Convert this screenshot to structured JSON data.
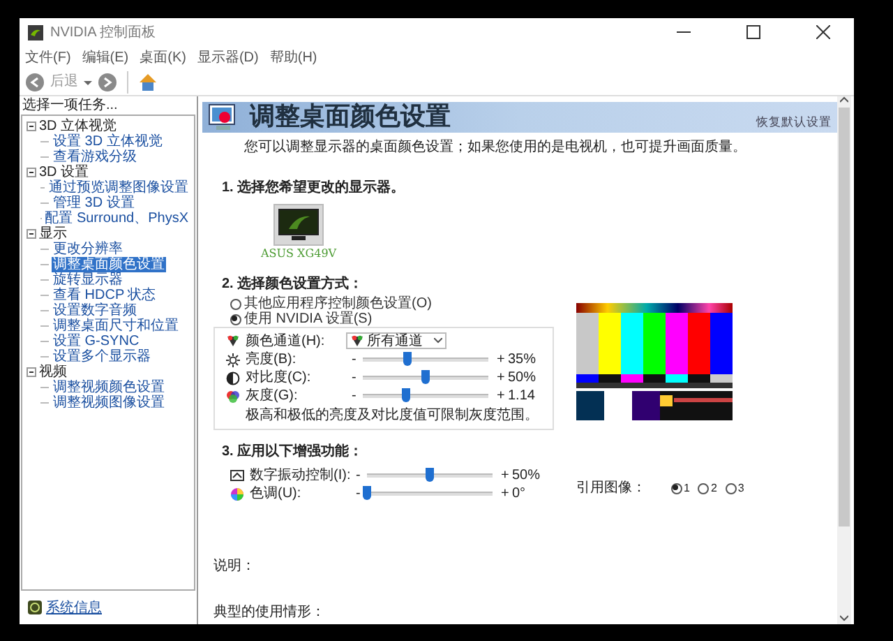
{
  "window": {
    "title": "NVIDIA 控制面板"
  },
  "menu": [
    "文件(F)",
    "编辑(E)",
    "桌面(K)",
    "显示器(D)",
    "帮助(H)"
  ],
  "toolbar": {
    "back_label": "后退"
  },
  "sidebar": {
    "heading": "选择一项任务...",
    "tree": [
      {
        "label": "3D 立体视觉",
        "expanded": true,
        "children": [
          {
            "label": "设置 3D 立体视觉",
            "selected": false
          },
          {
            "label": "查看游戏分级",
            "selected": false
          }
        ]
      },
      {
        "label": "3D 设置",
        "expanded": true,
        "children": [
          {
            "label": "通过预览调整图像设置",
            "selected": false
          },
          {
            "label": "管理 3D 设置",
            "selected": false
          },
          {
            "label": "配置 Surround、PhysX",
            "selected": false
          }
        ]
      },
      {
        "label": "显示",
        "expanded": true,
        "children": [
          {
            "label": "更改分辨率",
            "selected": false
          },
          {
            "label": "调整桌面颜色设置",
            "selected": true
          },
          {
            "label": "旋转显示器",
            "selected": false
          },
          {
            "label": "查看 HDCP 状态",
            "selected": false
          },
          {
            "label": "设置数字音频",
            "selected": false
          },
          {
            "label": "调整桌面尺寸和位置",
            "selected": false
          },
          {
            "label": "设置 G-SYNC",
            "selected": false
          },
          {
            "label": "设置多个显示器",
            "selected": false
          }
        ]
      },
      {
        "label": "视频",
        "expanded": true,
        "children": [
          {
            "label": "调整视频颜色设置",
            "selected": false
          },
          {
            "label": "调整视频图像设置",
            "selected": false
          }
        ]
      }
    ],
    "footer_link": "系统信息"
  },
  "page": {
    "title": "调整桌面颜色设置",
    "restore_link": "恢复默认设置",
    "description": "您可以调整显示器的桌面颜色设置；如果您使用的是电视机，也可提升画面质量。",
    "section1": {
      "heading": "1. 选择您希望更改的显示器。",
      "displays": [
        {
          "label": "ASUS XG49V",
          "selected": true
        }
      ]
    },
    "section2": {
      "heading": "2. 选择颜色设置方式：",
      "modes": [
        {
          "label": "其他应用程序控制颜色设置(O)",
          "selected": false
        },
        {
          "label": "使用 NVIDIA 设置(S)",
          "selected": true
        }
      ],
      "channel": {
        "label": "颜色通道(H):",
        "value": "所有通道"
      },
      "sliders": [
        {
          "kind": "brightness",
          "label": "亮度(B):",
          "decrease": "-",
          "increase": "+",
          "level": 0.35,
          "reading": "35%"
        },
        {
          "kind": "contrast",
          "label": "对比度(C):",
          "decrease": "-",
          "increase": "+",
          "level": 0.5,
          "reading": "50%"
        },
        {
          "kind": "gamma",
          "label": "灰度(G):",
          "decrease": "-",
          "increase": "+",
          "level": 0.34,
          "reading": "1.14"
        }
      ],
      "note": "极高和极低的亮度及对比度值可限制灰度范围。"
    },
    "section3": {
      "heading": "3. 应用以下增强功能：",
      "sliders": [
        {
          "kind": "vibrance",
          "label": "数字振动控制(I):",
          "decrease": "-",
          "increase": "+",
          "level": 0.5,
          "reading": "50%"
        },
        {
          "kind": "hue",
          "label": "色调(U):",
          "decrease": "-",
          "increase": "+",
          "level": 0.0,
          "reading": "0°"
        }
      ]
    },
    "reference": {
      "label": "引用图像：",
      "options": [
        {
          "label": "1",
          "selected": true
        },
        {
          "label": "2",
          "selected": false
        },
        {
          "label": "3",
          "selected": false
        }
      ]
    },
    "explanation_label": "说明：",
    "usage_label": "典型的使用情形："
  }
}
